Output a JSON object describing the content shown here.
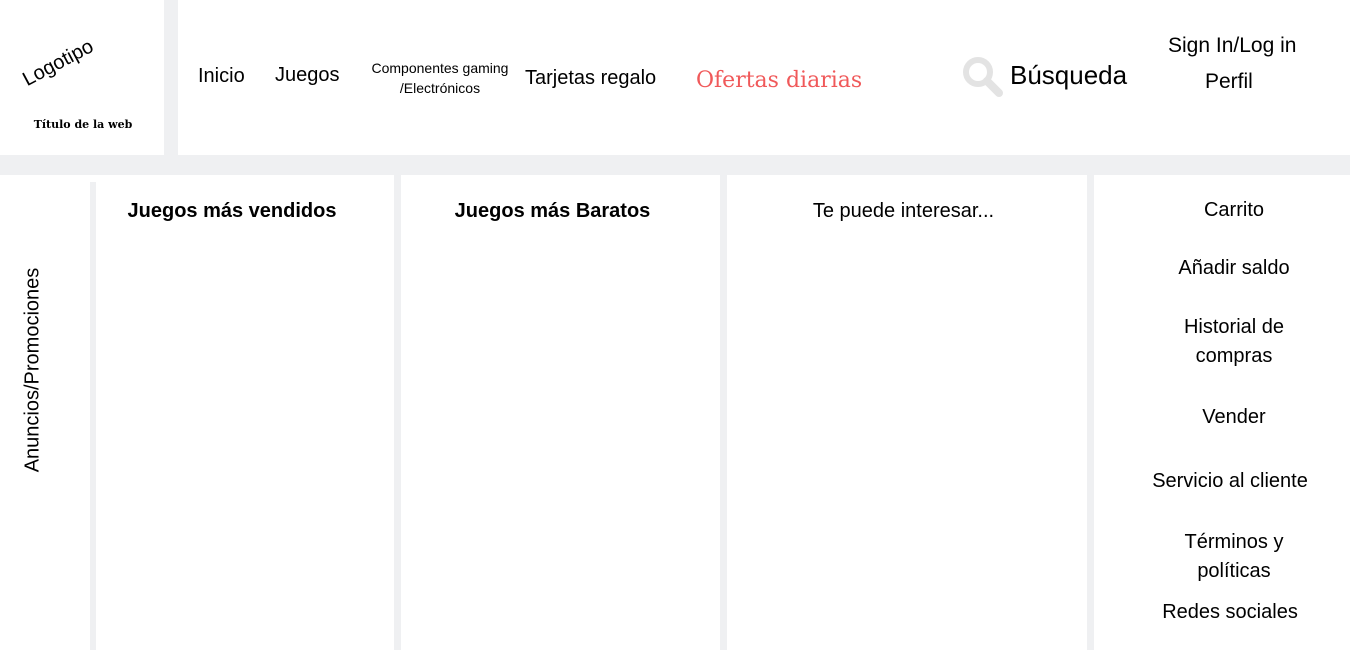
{
  "header": {
    "logo": "Logotipo",
    "site_title": "Título de la web",
    "nav": {
      "inicio": "Inicio",
      "juegos": "Juegos",
      "componentes_line1": "Componentes gaming",
      "componentes_line2": "/Electrónicos",
      "tarjetas": "Tarjetas regalo",
      "ofertas": "Ofertas diarias"
    },
    "search_label": "Búsqueda",
    "sign_in": "Sign In/Log in",
    "profile": "Perfil"
  },
  "main": {
    "ads": "Anuncios/Promociones",
    "best_sellers": "Juegos más vendidos",
    "cheapest": "Juegos más Baratos",
    "recommended": "Te puede interesar..."
  },
  "sidebar": {
    "items": [
      "Carrito",
      "Añadir saldo",
      "Historial de compras",
      "Vender",
      "Servicio al cliente",
      "Términos y políticas",
      "Redes sociales"
    ]
  },
  "colors": {
    "accent": "#f0595a",
    "divider": "#eff0f2",
    "icon": "#e3e3e3"
  }
}
